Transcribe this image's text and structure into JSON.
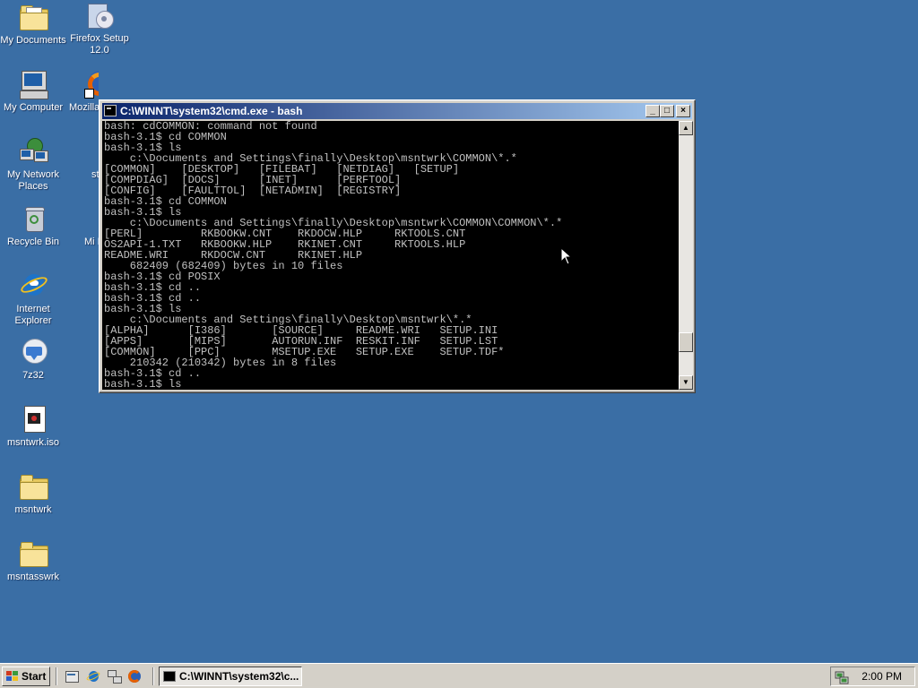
{
  "desktop": {
    "icons": [
      {
        "label": "My Documents"
      },
      {
        "label": "Firefox Setup 12.0"
      },
      {
        "label": "My Computer"
      },
      {
        "label": "Mozilla"
      },
      {
        "label": "My Network Places"
      },
      {
        "label": "st"
      },
      {
        "label": "Recycle Bin"
      },
      {
        "label": "Mi Inst"
      },
      {
        "label": "Internet Explorer"
      },
      {
        "label": "7z32"
      },
      {
        "label": "msntwrk.iso"
      },
      {
        "label": "msntwrk"
      },
      {
        "label": "msntasswrk"
      }
    ]
  },
  "window": {
    "title": "C:\\WINNT\\system32\\cmd.exe - bash",
    "buttons": {
      "minimize": "_",
      "maximize": "□",
      "close": "×"
    }
  },
  "console": {
    "lines": [
      "bash: cdCOMMON: command not found",
      "bash-3.1$ cd COMMON",
      "bash-3.1$ ls",
      "    c:\\Documents and Settings\\finally\\Desktop\\msntwrk\\COMMON\\*.*",
      "[COMMON]    [DESKTOP]   [FILEBAT]   [NETDIAG]   [SETUP]",
      "[COMPDIAG]  [DOCS]      [INET]      [PERFTOOL]",
      "[CONFIG]    [FAULTTOL]  [NETADMIN]  [REGISTRY]",
      "bash-3.1$ cd COMMON",
      "bash-3.1$ ls",
      "    c:\\Documents and Settings\\finally\\Desktop\\msntwrk\\COMMON\\COMMON\\*.*",
      "[PERL]         RKBOOKW.CNT    RKDOCW.HLP     RKTOOLS.CNT",
      "OS2API-1.TXT   RKBOOKW.HLP    RKINET.CNT     RKTOOLS.HLP",
      "README.WRI     RKDOCW.CNT     RKINET.HLP",
      "    682409 (682409) bytes in 10 files",
      "bash-3.1$ cd POSIX",
      "bash-3.1$ cd ..",
      "bash-3.1$ cd ..",
      "bash-3.1$ ls",
      "    c:\\Documents and Settings\\finally\\Desktop\\msntwrk\\*.*",
      "[ALPHA]      [I386]       [SOURCE]     README.WRI   SETUP.INI",
      "[APPS]       [MIPS]       AUTORUN.INF  RESKIT.INF   SETUP.LST",
      "[COMMON]     [PPC]        MSETUP.EXE   SETUP.EXE    SETUP.TDF*",
      "    210342 (210342) bytes in 8 files",
      "bash-3.1$ cd ..",
      "bash-3.1$ ls"
    ]
  },
  "taskbar": {
    "start_label": "Start",
    "task_label": "C:\\WINNT\\system32\\c...",
    "clock": "2:00 PM"
  },
  "colors": {
    "desktop": "#3a6ea5",
    "titlebar_start": "#0a246a",
    "titlebar_end": "#a6caf0",
    "console_bg": "#000000",
    "console_text": "#c0c0c0"
  }
}
